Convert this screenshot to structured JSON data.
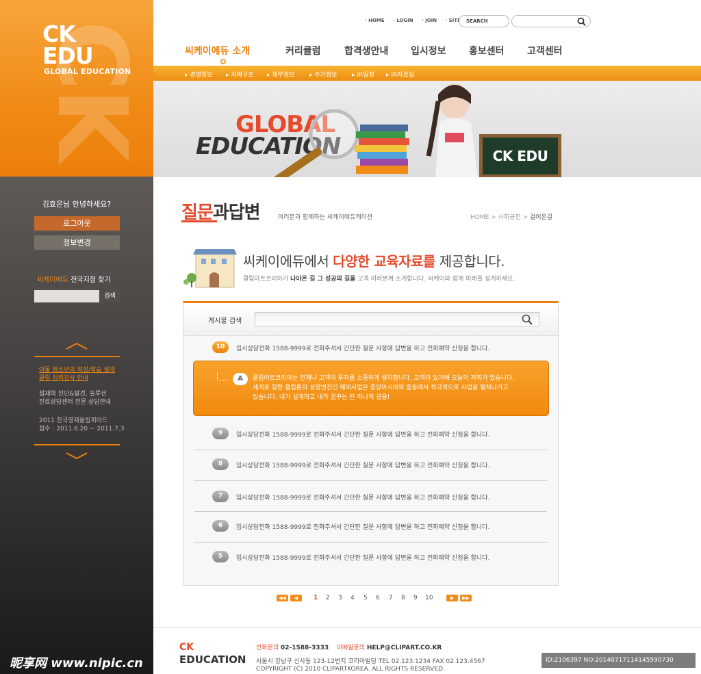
{
  "logo": {
    "line1": "CK",
    "line2": "EDU",
    "sub": "GLOBAL EDUCATION",
    "watermark": "CK EDU"
  },
  "sidebar": {
    "greeting": "김효은님 안녕하세요?",
    "logout": "로그아웃",
    "profile": "정보변경",
    "branch_brand": "씨케이에듀",
    "branch_title": "전국지점 찾기",
    "branch_button": "검색",
    "promo1": [
      "아동 청소년의 적성/학습 설계",
      "클립 심리검사 안내"
    ],
    "promo2": [
      "잠재력 진단&발견, 솔루션",
      "진료상담센터 전문 상담안내"
    ],
    "promo3": [
      "2011 한국영재올림피아드",
      "접수 : 2011.6.20 ~ 2011.7.3"
    ]
  },
  "top_links": [
    "· HOME",
    "· LOGIN",
    "· JOIN",
    "· SITEMAP"
  ],
  "search_top_label": "SEARCH",
  "main_menu": [
    "씨케이에듀 소개",
    "커리큘럼",
    "합격생안내",
    "입시정보",
    "홍보센터",
    "고객센터"
  ],
  "sub_menu": [
    "경영정보",
    "지배구조",
    "채무정보",
    "추가정보",
    "IR일정",
    "IR자료실"
  ],
  "banner": {
    "global": "GLOBAL",
    "education": "EDUCATION",
    "board": "CK EDU"
  },
  "page": {
    "title_accent": "질문",
    "title_rest": "과답변",
    "subtitle": "여러분과 함께하는 씨케이에듀케이션",
    "breadcrumb": [
      "HOME",
      "사회공헌",
      "걸어온길"
    ]
  },
  "hero": {
    "pre": "씨케이에듀에서 ",
    "bold": "다양한 교육자료를",
    "post": " 제공합니다.",
    "sub_pre": "클립아트코리아가 ",
    "sub_bold": "나아온 길 그 성공의 길을",
    "sub_post": " 고객 여러분께 소개합니다. 씨케이와 함께 미래를 설계하세요."
  },
  "board": {
    "search_label": "게시물 검색",
    "rows": [
      {
        "num": "10",
        "text": "입시상담전화 1588-9999로 전화주셔서 간단한 질문 사항에 답변을 하고 전화예약 신청을 합니다."
      },
      {
        "num": "9",
        "text": "입시상담전화 1588-9999로 전화주셔서 간단한 질문 사항에 답변을 하고 전화예약 신청을 합니다."
      },
      {
        "num": "8",
        "text": "입시상담전화 1588-9999로 전화주셔서 간단한 질문 사항에 답변을 하고 전화예약 신청을 합니다."
      },
      {
        "num": "7",
        "text": "입시상담전화 1588-9999로 전화주셔서 간단한 질문 사항에 답변을 하고 전화예약 신청을 합니다."
      },
      {
        "num": "6",
        "text": "입시상담전화 1588-9999로 전화주셔서 간단한 질문 사항에 답변을 하고 전화예약 신청을 합니다."
      },
      {
        "num": "5",
        "text": "입시상담전화 1588-9999로 전화주셔서 간단한 질문 사항에 답변을 하고 전화예약 신청을 합니다."
      }
    ],
    "answer_badge": "A",
    "answer_lines": [
      "클립아트코리아는 언제나 고객의 투자를 소중하게 생각합니다. 고객이 있기에 오늘의 저희가 있습니다.",
      "세계로 향한 클립툰의 성장엔진인 해외사업은 중앙아시아와 중동에서 적극적으로 사업을 펼쳐나가고",
      "있습니다. 내가 설계하고 내가 꿈꾸는 단 하나의 금융!"
    ]
  },
  "pager": {
    "first": "◀◀",
    "prev": "◀",
    "pages": [
      "1",
      "2",
      "3",
      "4",
      "5",
      "6",
      "7",
      "8",
      "9",
      "10"
    ],
    "current": "1",
    "next": "▶",
    "last": "▶▶"
  },
  "footer": {
    "ck": "CK",
    "education": "EDUCATION",
    "phone_label": "전화문의",
    "phone": "02-1588-3333",
    "email_label": "이메일문의",
    "email": "HELP@CLIPART.CO.KR",
    "address": "서울시 강남구 신사동 123-12번지 코리아빌딩  TEL 02.123.1234   FAX 02.123.4567",
    "copyright": "COPYRIGHT (C) 2010 CLIPARTKOREA. ALL RIGHTS RESERVED.",
    "id_stamp": "ID:2106397 NO:20140717114145590730",
    "site_watermark": "昵享网 www.nipic.cn"
  },
  "colors": {
    "accent": "#ec7f0c",
    "accent_red": "#e44a2b",
    "sidebar_dark": "#3c3a39"
  }
}
